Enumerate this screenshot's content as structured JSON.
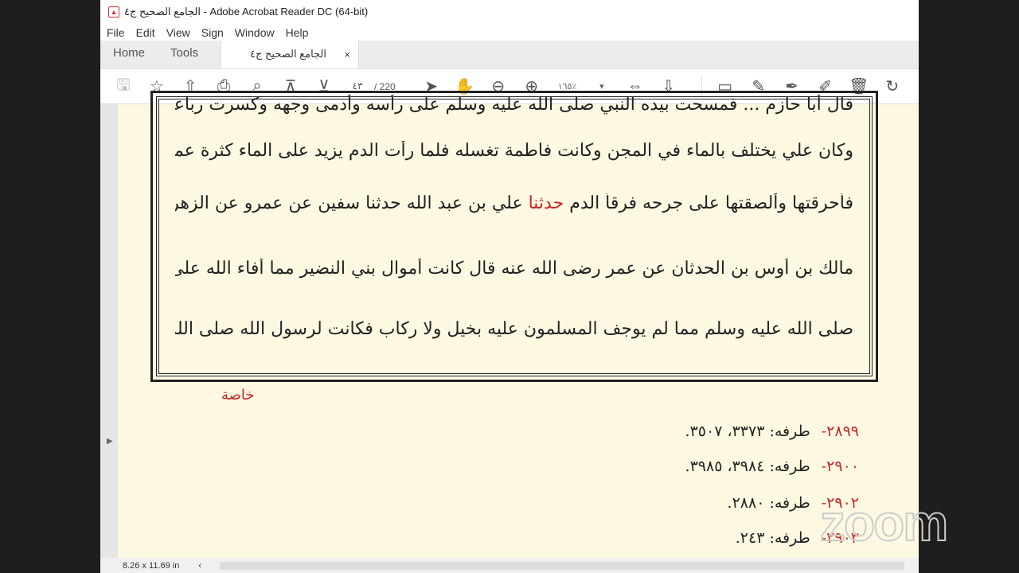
{
  "window": {
    "title": "الجامع الصحيح ج٤ - Adobe Acrobat Reader DC (64-bit)"
  },
  "menu": [
    "File",
    "Edit",
    "View",
    "Sign",
    "Window",
    "Help"
  ],
  "tabs": {
    "home": "Home",
    "tools": "Tools",
    "document": "الجامع الصحيح ج٤",
    "close": "×"
  },
  "toolbar": {
    "page_current": "٤٣",
    "page_total": "/ 220",
    "zoom": "١٦٥٪"
  },
  "document": {
    "lines": [
      "قال أبا حازم ... فمسحت بيده النبي صلى الله عليه وسلم على رأسه وأدمى وجهه وكسرت رباعيته",
      "وكان علي يختلف بالماء في المجن وكانت فاطمة تغسله فلما رأت الدم يزيد على الماء كثرة عمدت إلى حصير",
      [
        "فأحرقتها وألصقتها على جرحه فرقأ الدم ",
        "حدثنا",
        " علي بن عبد الله حدثنا سفين عن عمرو عن الزهري عن"
      ],
      "مالك بن أوس بن الحدثان عن عمر رضى الله عنه قال كانت أموال بني النضير مما أفاء الله على رسوله",
      "صلى الله عليه وسلم مما لم يوجف المسلمون عليه بخيل ولا ركاب فكانت لرسول الله صلى الله عليه وسلم"
    ],
    "margin_note": "خاصة",
    "refs": [
      {
        "num": "٢٨٩٩-",
        "label": "طرفه:",
        "value": "٣٣٧٣، ٣٥٠٧."
      },
      {
        "num": "٢٩٠٠-",
        "label": "طرفه:",
        "value": "٣٩٨٤، ٣٩٨٥."
      },
      {
        "num": "٢٩٠٢-",
        "label": "طرفه:",
        "value": "٢٨٨٠."
      },
      {
        "num": "٢٩٠٣-",
        "label": "طرفه:",
        "value": "٢٤٣."
      }
    ]
  },
  "status": {
    "page_size": "8.26 x 11.69 in"
  },
  "watermark": "zoom"
}
